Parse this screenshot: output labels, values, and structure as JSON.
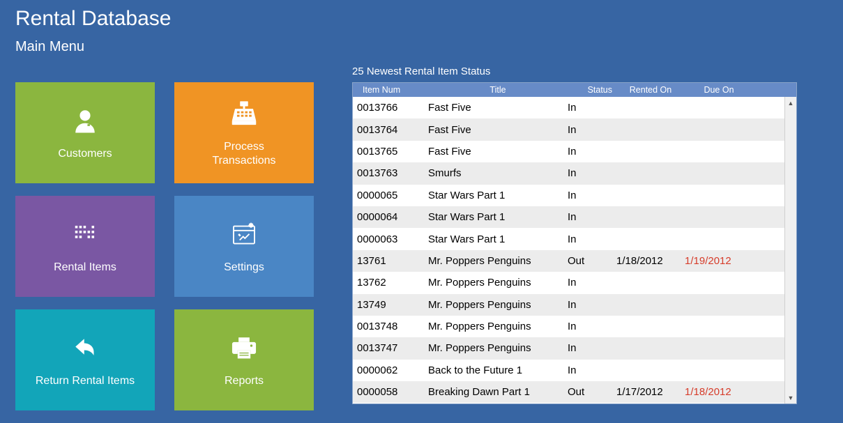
{
  "title": "Rental Database",
  "subtitle": "Main Menu",
  "tiles": [
    {
      "label": "Customers"
    },
    {
      "label": "Process\nTransactions"
    },
    {
      "label": "Rental Items"
    },
    {
      "label": "Settings"
    },
    {
      "label": "Return Rental Items"
    },
    {
      "label": "Reports"
    }
  ],
  "panel": {
    "title": "25 Newest Rental Item Status",
    "columns": {
      "item_num": "Item Num",
      "title": "Title",
      "status": "Status",
      "rented_on": "Rented On",
      "due_on": "Due On"
    },
    "rows": [
      {
        "item_num": "0013766",
        "title": "Fast Five",
        "status": "In",
        "rented_on": "",
        "due_on": "",
        "overdue": false
      },
      {
        "item_num": "0013764",
        "title": "Fast Five",
        "status": "In",
        "rented_on": "",
        "due_on": "",
        "overdue": false
      },
      {
        "item_num": "0013765",
        "title": "Fast Five",
        "status": "In",
        "rented_on": "",
        "due_on": "",
        "overdue": false
      },
      {
        "item_num": "0013763",
        "title": "Smurfs",
        "status": "In",
        "rented_on": "",
        "due_on": "",
        "overdue": false
      },
      {
        "item_num": "0000065",
        "title": "Star Wars Part 1",
        "status": "In",
        "rented_on": "",
        "due_on": "",
        "overdue": false
      },
      {
        "item_num": "0000064",
        "title": "Star Wars Part 1",
        "status": "In",
        "rented_on": "",
        "due_on": "",
        "overdue": false
      },
      {
        "item_num": "0000063",
        "title": "Star Wars Part 1",
        "status": "In",
        "rented_on": "",
        "due_on": "",
        "overdue": false
      },
      {
        "item_num": "13761",
        "title": "Mr. Poppers Penguins",
        "status": "Out",
        "rented_on": "1/18/2012",
        "due_on": "1/19/2012",
        "overdue": true
      },
      {
        "item_num": "13762",
        "title": "Mr. Poppers Penguins",
        "status": "In",
        "rented_on": "",
        "due_on": "",
        "overdue": false
      },
      {
        "item_num": "13749",
        "title": "Mr. Poppers Penguins",
        "status": "In",
        "rented_on": "",
        "due_on": "",
        "overdue": false
      },
      {
        "item_num": "0013748",
        "title": "Mr. Poppers Penguins",
        "status": "In",
        "rented_on": "",
        "due_on": "",
        "overdue": false
      },
      {
        "item_num": "0013747",
        "title": "Mr. Poppers Penguins",
        "status": "In",
        "rented_on": "",
        "due_on": "",
        "overdue": false
      },
      {
        "item_num": "0000062",
        "title": "Back to the Future 1",
        "status": "In",
        "rented_on": "",
        "due_on": "",
        "overdue": false
      },
      {
        "item_num": "0000058",
        "title": "Breaking Dawn Part 1",
        "status": "Out",
        "rented_on": "1/17/2012",
        "due_on": "1/18/2012",
        "overdue": true
      }
    ]
  }
}
